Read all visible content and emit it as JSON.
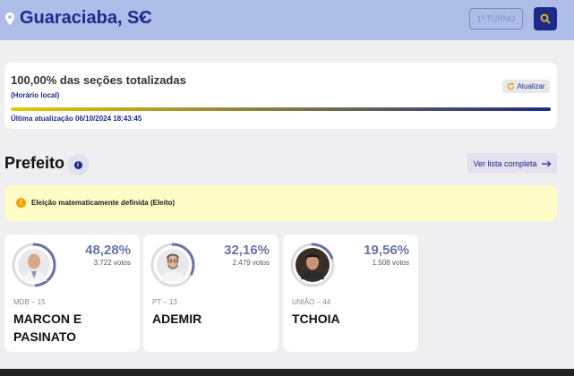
{
  "header": {
    "city": "Guaraciaba, SC",
    "turno_label": "1º TURNO",
    "icons": [
      "location-pin-icon",
      "chevron-down-icon",
      "search-icon"
    ],
    "colors": {
      "bar_bg": "#aebce8",
      "brand": "#1e2a8a"
    }
  },
  "status": {
    "title": "100,00% das seções totalizadas",
    "subtitle": "(Horário local)",
    "refresh_label": "Atualizar",
    "progress": 1.0,
    "last_update": "Última atualização 06/10/2024 18:43:45"
  },
  "section": {
    "title": "Prefeito",
    "view_all_label": "Ver lista completa",
    "alert": "Eleição matematicamente definida (Eleito)"
  },
  "candidates": [
    {
      "party": "MDB – 15",
      "name": "MARCON E PASINATO",
      "percent": "48,28%",
      "votes": "3.722 votos",
      "share": 0.4828
    },
    {
      "party": "PT – 13",
      "name": "ADEMIR",
      "percent": "32,16%",
      "votes": "2.479 votos",
      "share": 0.3216
    },
    {
      "party": "UNIÃO – 44",
      "name": "TCHOIA",
      "percent": "19,56%",
      "votes": "1.508 votos",
      "share": 0.1956
    }
  ]
}
